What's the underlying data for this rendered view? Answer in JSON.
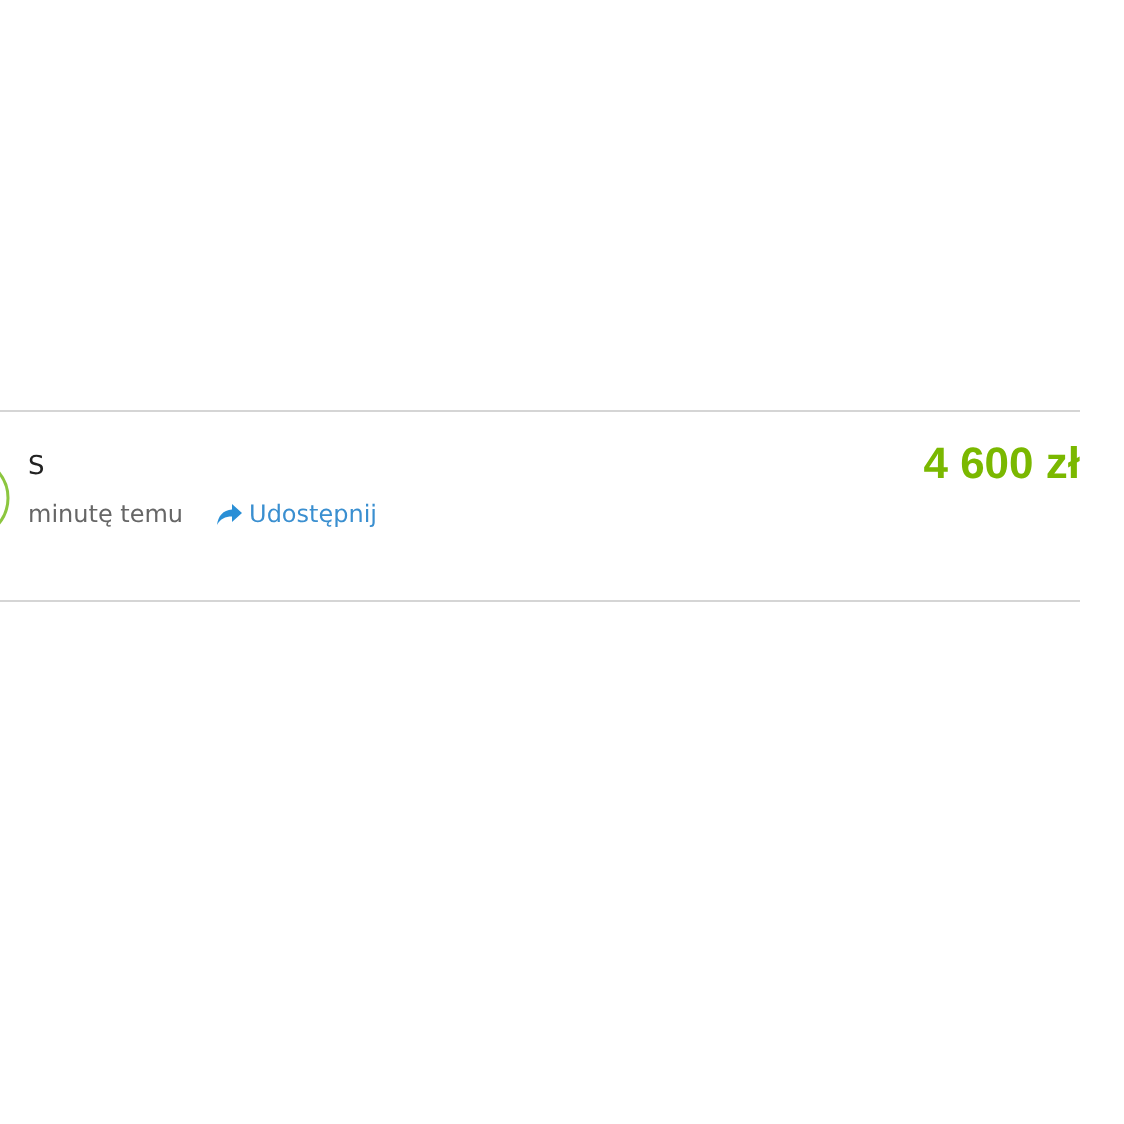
{
  "donation": {
    "name": "S",
    "time": "minutę temu",
    "share_label": "Udostępnij",
    "amount": "4 600 zł"
  }
}
